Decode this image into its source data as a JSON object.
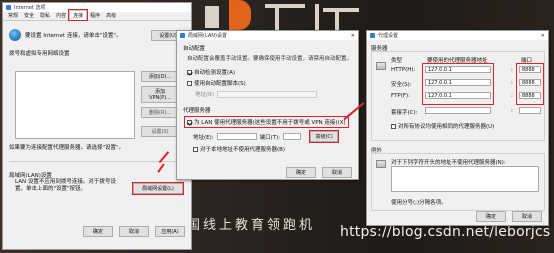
{
  "win1": {
    "title": "Internet 选项",
    "tabs": [
      "常规",
      "安全",
      "隐私",
      "内容",
      "连接",
      "程序",
      "高级"
    ],
    "setup_text": "要设置 Internet 连接，请单击\"设置\"。",
    "setup_button": "设置(U)",
    "vpn_section": "拨号和虚拟专用网络设置",
    "add_button": "添加(D)...",
    "add_vpn_button": "添加 VPN(P)...",
    "remove_button": "删除(R)...",
    "settings_button": "设置(S)",
    "proxy_note": "如果要为连接配置代理服务器，请选择\"设置\"。",
    "lan_section": "局域网(LAN)设置",
    "lan_desc": "LAN 设置不应用到拨号连接。对于拨号设置，单击上面的\"设置\"按钮。",
    "lan_button": "局域网设置(L)",
    "ok": "确定",
    "cancel": "取消",
    "apply": "应用(A)"
  },
  "win2": {
    "title": "局域网(LAN)设置",
    "auto_section": "自动配置",
    "auto_desc": "自动配置会覆盖手动设置。要确保使用手动设置，请禁用自动配置。",
    "auto_detect": "自动检测设置(A)",
    "use_script": "使用自动配置脚本(S)",
    "address_label": "地址(R)",
    "proxy_section": "代理服务器",
    "use_proxy": "为 LAN 使用代理服务器(这些设置不用于拨号或 VPN 连接)(X)",
    "addr_label": "地址(E):",
    "port_label": "端口(T):",
    "advanced_button": "高级(C)",
    "bypass_local": "对于本地地址不使用代理服务器(B)",
    "ok": "确定",
    "cancel": "取消"
  },
  "win3": {
    "title": "代理设置",
    "servers_section": "服务器",
    "col_type": "类型",
    "col_address": "要使用的代理服务器地址",
    "col_port": "端口",
    "rows": [
      {
        "label": "HTTP(H):",
        "address": "127.0.0.1",
        "port": "8888"
      },
      {
        "label": "安全(S):",
        "address": "127.0.0.1",
        "port": "8888"
      },
      {
        "label": "FTP(F):",
        "address": "127.0.0.1",
        "port": "8888"
      },
      {
        "label": "套接字(C):",
        "address": "",
        "port": ""
      }
    ],
    "same_proxy": "对所有协议均使用相同的代理服务器(U)",
    "exceptions_section": "例外",
    "exceptions_desc": "对于下列字符开头的地址不使用代理服务器(N):",
    "exceptions_note": "使用分号(;)分隔各项。",
    "ok": "确定",
    "cancel": "取消"
  },
  "background": {
    "banner": "国线上教育领跑机",
    "watermark": "https://blog.csdn.net/leborjcs"
  },
  "colors": {
    "highlight": "#e0202a",
    "accent": "#2f7fd0"
  }
}
